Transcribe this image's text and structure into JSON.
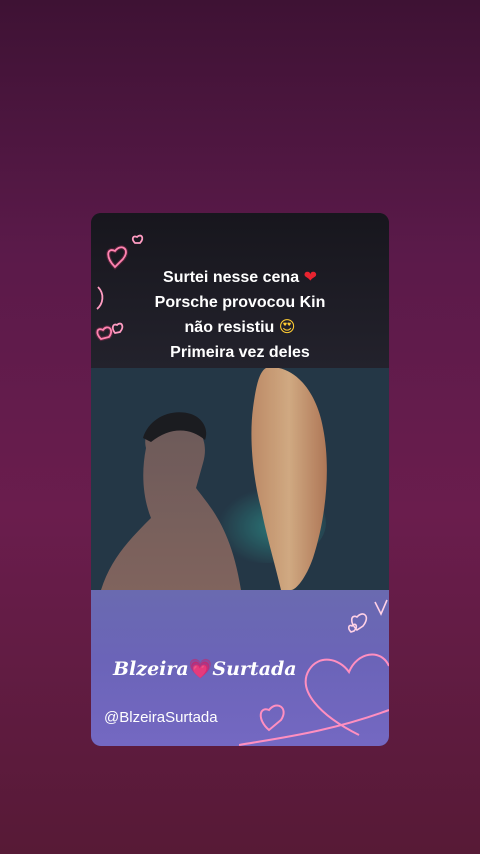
{
  "story": {
    "caption_lines": [
      "Surtei nesse cena",
      "Porsche provocou Kin",
      "não resistiu",
      "Primeira vez deles"
    ],
    "emoji_line1": "❤",
    "emoji_line3": "😍",
    "brand_left": "Blzeira",
    "brand_heart": "💗",
    "brand_right": "Surtada",
    "handle": "@BlzeiraSurtada"
  },
  "colors": {
    "background_top": "#3e1234",
    "background_bottom": "#571a36",
    "caption_bg": "#17161d",
    "bottom_panel": "#6b64b8",
    "neon_pink": "#ff4f8e"
  },
  "icons": [
    "neon-heart-icon",
    "red-heart-emoji",
    "heart-eyes-emoji",
    "pink-heart-emoji"
  ]
}
